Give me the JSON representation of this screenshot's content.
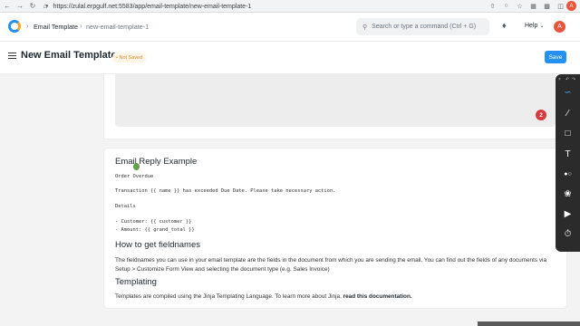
{
  "browser": {
    "url": "https://zulal.erpgulf.net:5583/app/email-template/new-email-template-1",
    "profile_initial": "A"
  },
  "navbar": {
    "breadcrumbs": [
      {
        "label": "Email Template"
      },
      {
        "label": "new-email-template-1"
      }
    ],
    "search_placeholder": "Search or type a command (Ctrl + G)",
    "help_label": "Help",
    "avatar_initial": "A"
  },
  "page": {
    "title": "New Email Template",
    "status": "Not Saved",
    "save_label": "Save"
  },
  "notification_count": "2",
  "help_section": {
    "example_title": "Email Reply Example",
    "example_lines": [
      "Order Overdue",
      "Transaction {{ name }} has exceeded Due Date. Please take necessary action.",
      "Details",
      "- Customer: {{ customer }}",
      "- Amount: {{ grand_total }}"
    ],
    "fieldnames_title": "How to get fieldnames",
    "fieldnames_text": "The fieldnames you can use in your email template are the fields in the document from which you are sending the email. You can find out the fields of any documents via Setup > Customize Form View and selecting the document type (e.g. Sales Invoice)",
    "templating_title": "Templating",
    "templating_text": "Templates are compiled using the Jinja Templating Language. To learn more about Jinja,",
    "templating_link": "read this documentation."
  },
  "colors": {
    "primary": "#2490ef",
    "badge": "#d63b3b",
    "not_saved": "#d98a2b"
  }
}
